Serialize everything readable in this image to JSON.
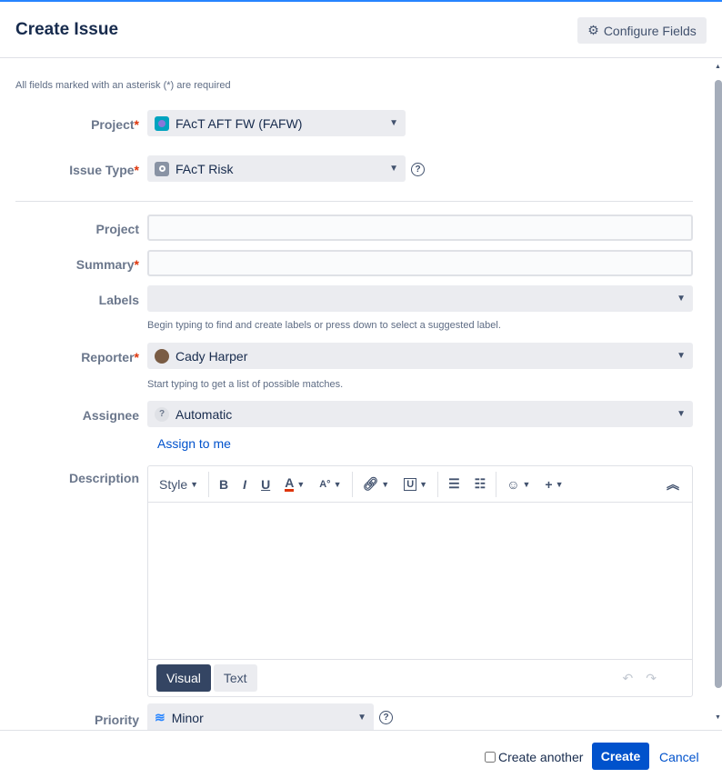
{
  "header": {
    "title": "Create Issue",
    "configure_label": "Configure Fields"
  },
  "note": "All fields marked with an asterisk (*) are required",
  "fields": {
    "project_label": "Project",
    "project_value": "FAcT AFT FW (FAFW)",
    "issue_type_label": "Issue Type",
    "issue_type_value": "FAcT Risk",
    "project2_label": "Project",
    "summary_label": "Summary",
    "labels_label": "Labels",
    "labels_hint": "Begin typing to find and create labels or press down to select a suggested label.",
    "reporter_label": "Reporter",
    "reporter_value": "Cady Harper",
    "reporter_hint": "Start typing to get a list of possible matches.",
    "assignee_label": "Assignee",
    "assignee_value": "Automatic",
    "assign_to_me": "Assign to me",
    "description_label": "Description",
    "priority_label": "Priority",
    "priority_value": "Minor",
    "required_mark": "*"
  },
  "editor": {
    "style_label": "Style",
    "visual_tab": "Visual",
    "text_tab": "Text",
    "bold": "B",
    "italic": "I",
    "underline": "U",
    "color": "A"
  },
  "footer": {
    "create_another": "Create another",
    "create": "Create",
    "cancel": "Cancel"
  },
  "colors": {
    "primary": "#0052cc",
    "accent": "#2684ff"
  }
}
